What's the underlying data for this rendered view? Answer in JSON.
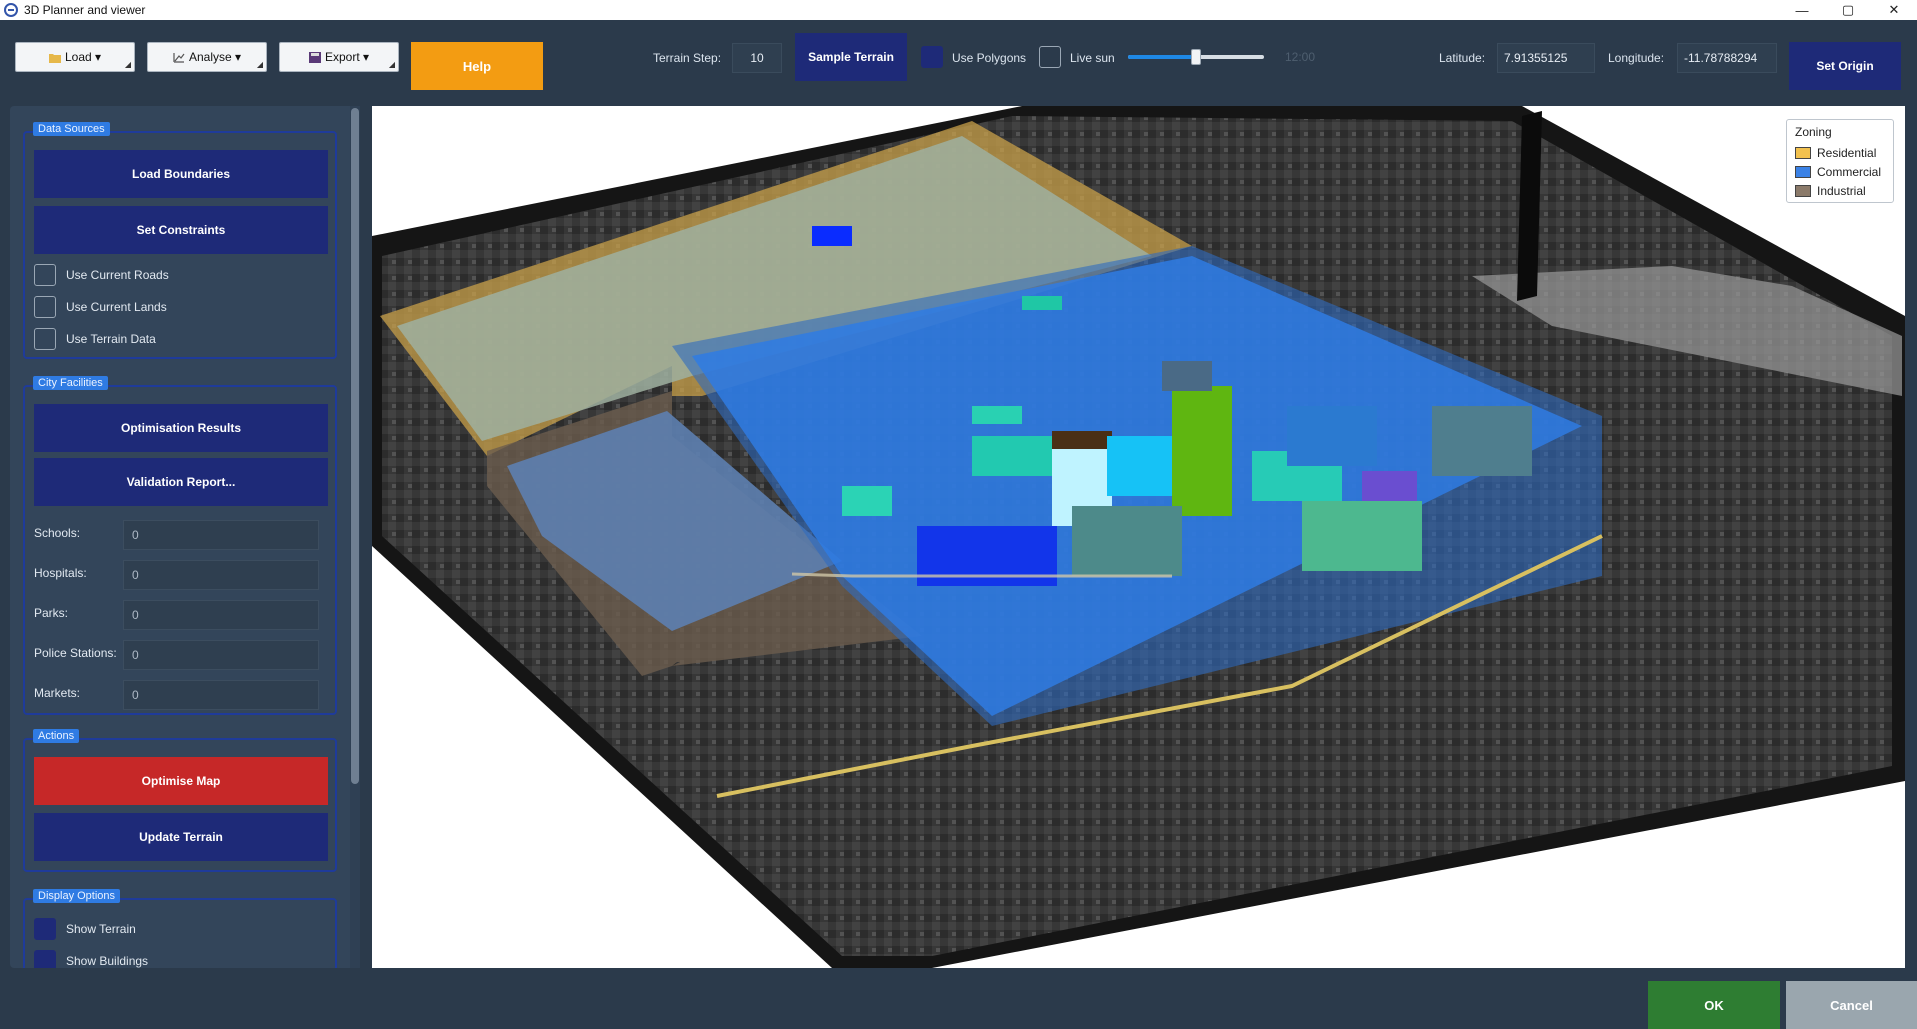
{
  "window": {
    "title": "3D Planner and viewer",
    "controls": [
      "—",
      "▢",
      "✕"
    ]
  },
  "toolbar": {
    "load_label": "Load ▾",
    "analyse_label": "Analyse ▾",
    "export_label": "Export ▾",
    "help_label": "Help",
    "terrain_step_label": "Terrain Step:",
    "terrain_step_value": "10",
    "sample_terrain_label": "Sample Terrain",
    "use_polygons_label": "Use Polygons",
    "use_polygons_checked": true,
    "live_sun_label": "Live sun",
    "live_sun_checked": false,
    "sun_slider_value": 0.5,
    "sun_time": "12:00",
    "latitude_label": "Latitude:",
    "latitude_value": "7.91355125",
    "longitude_label": "Longitude:",
    "longitude_value": "-11.78788294",
    "set_origin_label": "Set Origin"
  },
  "sidebar": {
    "data_sources": {
      "title": "Data Sources",
      "load_boundaries_label": "Load Boundaries",
      "set_constraints_label": "Set Constraints",
      "checks": [
        {
          "label": "Use Current Roads",
          "checked": false
        },
        {
          "label": "Use Current Lands",
          "checked": false
        },
        {
          "label": "Use Terrain Data",
          "checked": false
        }
      ]
    },
    "city_facilities": {
      "title": "City Facilities",
      "optimisation_results_label": "Optimisation Results",
      "validation_report_label": "Validation Report...",
      "fields": [
        {
          "label": "Schools:",
          "value": "0"
        },
        {
          "label": "Hospitals:",
          "value": "0"
        },
        {
          "label": "Parks:",
          "value": "0"
        },
        {
          "label": "Police Stations:",
          "value": "0"
        },
        {
          "label": "Markets:",
          "value": "0"
        }
      ]
    },
    "actions": {
      "title": "Actions",
      "optimise_map_label": "Optimise Map",
      "update_terrain_label": "Update Terrain"
    },
    "display_options": {
      "title": "Display Options",
      "checks": [
        {
          "label": "Show Terrain",
          "checked": true
        },
        {
          "label": "Show Buildings",
          "checked": true
        }
      ]
    }
  },
  "legend": {
    "title": "Zoning",
    "items": [
      {
        "label": "Residential",
        "color": "#f2c14e"
      },
      {
        "label": "Commercial",
        "color": "#3b82e6"
      },
      {
        "label": "Industrial",
        "color": "#8b7a6a"
      }
    ]
  },
  "dialog": {
    "ok_label": "OK",
    "cancel_label": "Cancel"
  },
  "colors": {
    "navy": "#1e2a78",
    "accent_orange": "#f39c12",
    "danger_red": "#c62828",
    "ok_green": "#2e7d32"
  }
}
